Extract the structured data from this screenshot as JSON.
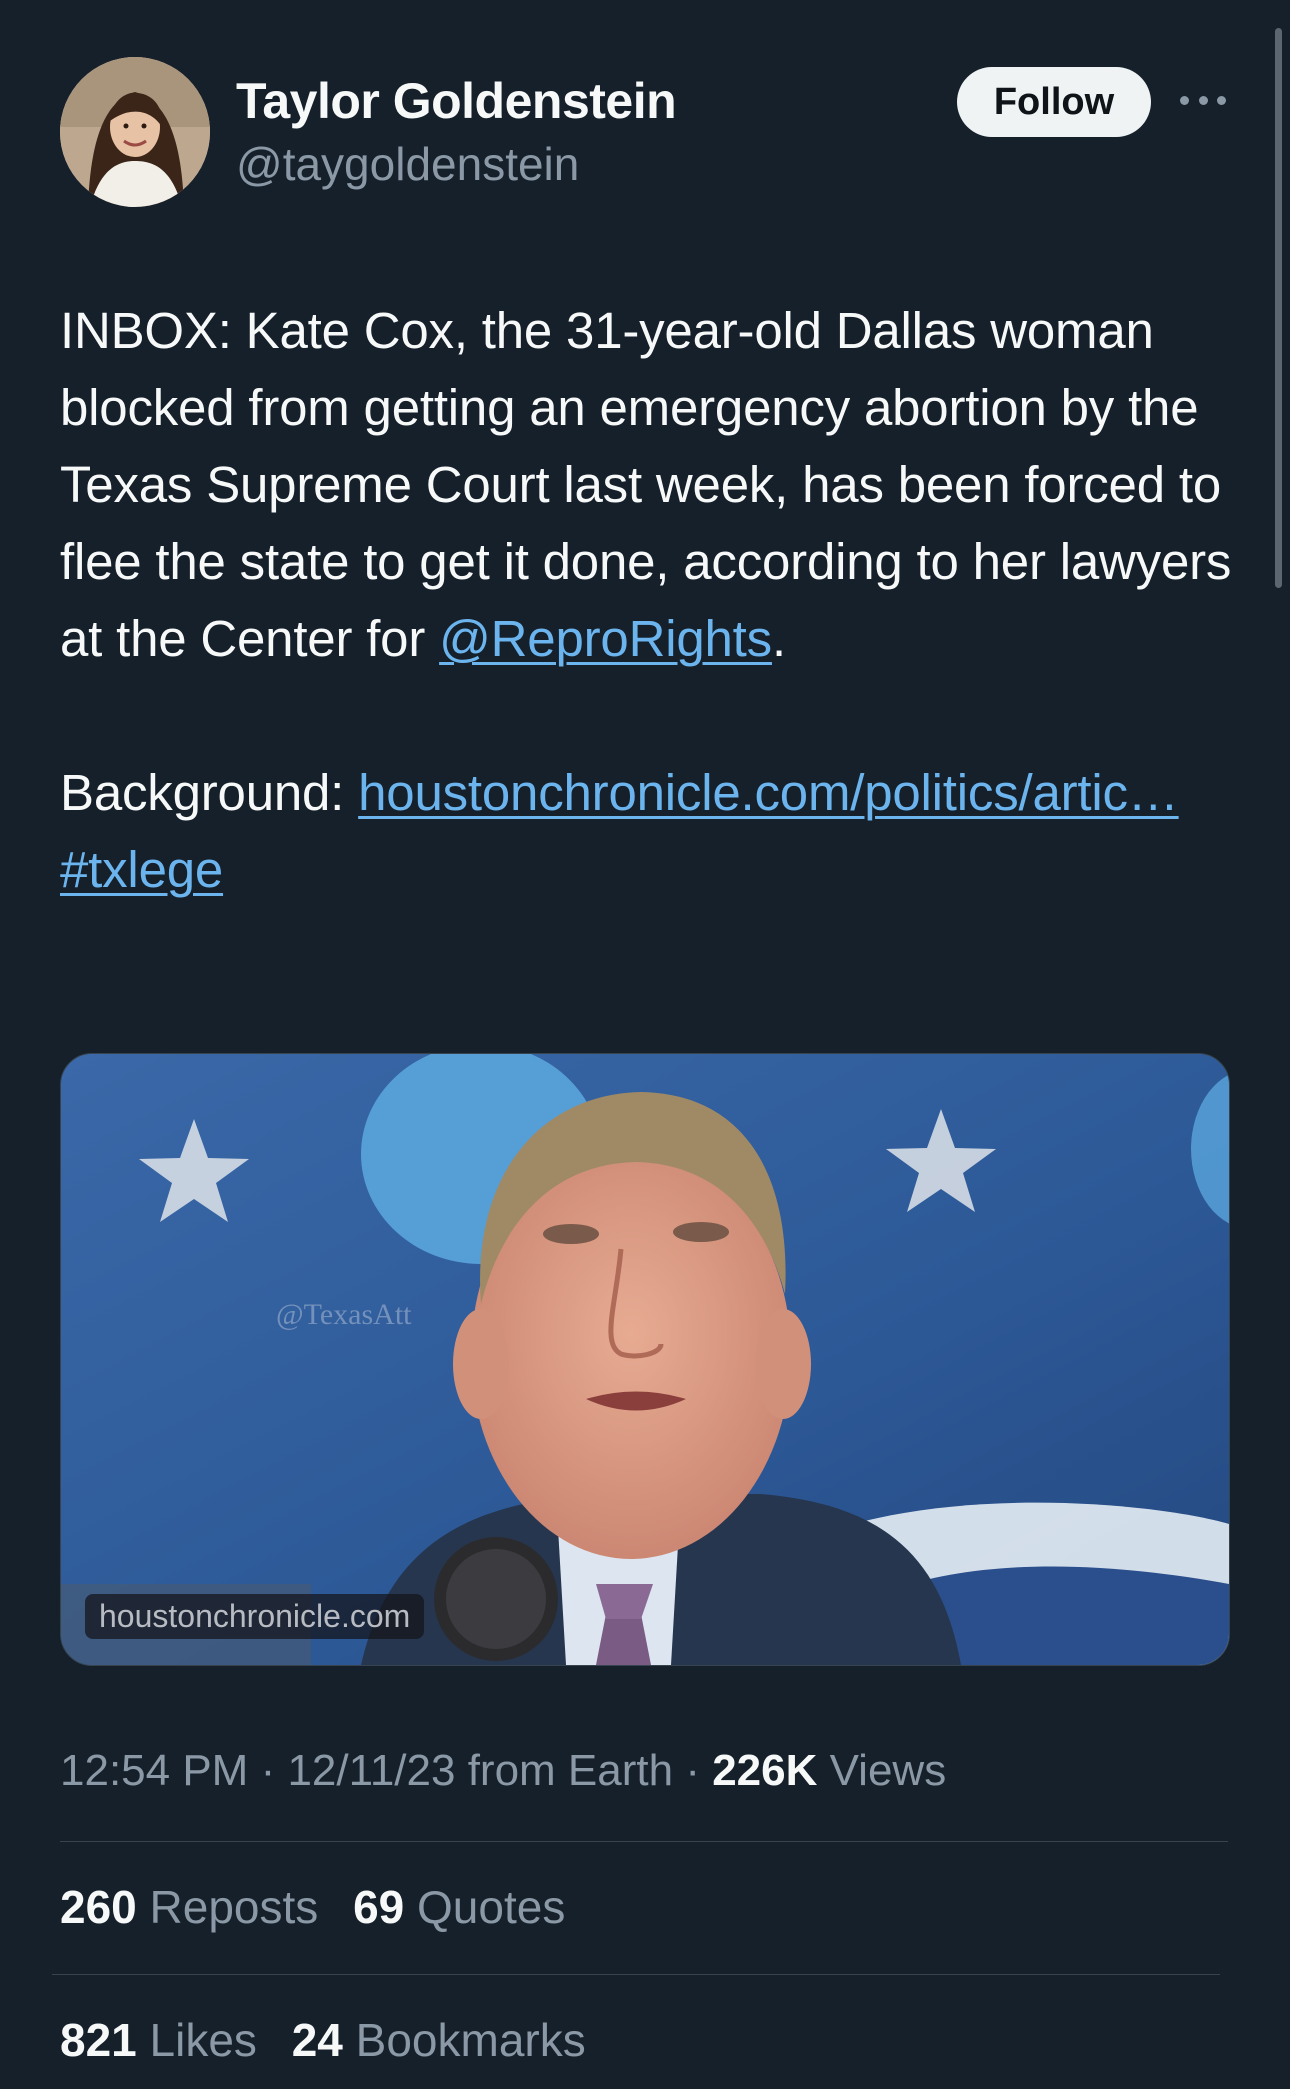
{
  "author": {
    "display_name": "Taylor Goldenstein",
    "handle": "@taygoldenstein",
    "follow_label": "Follow"
  },
  "tweet": {
    "text_part1": "INBOX: Kate Cox, the 31-year-old Dallas woman blocked from getting an emergency abortion by the Texas Supreme Court last week, has been forced to flee the state to get it done, according to her lawyers at the Center for ",
    "mention": "@ReproRights",
    "text_part1_end": ".",
    "background_label": "Background: ",
    "link_text": "houstonchronicle.com/politics/artic…",
    "hashtag": "#txlege"
  },
  "media": {
    "caption": "houstonchronicle.com"
  },
  "meta": {
    "time": "12:54 PM",
    "separator1": " · ",
    "date": "12/11/23",
    "source": " from Earth",
    "separator2": " · ",
    "views_count": "226K",
    "views_label": " Views"
  },
  "stats": {
    "reposts_count": "260",
    "reposts_label": "Reposts",
    "quotes_count": "69",
    "quotes_label": "Quotes",
    "likes_count": "821",
    "likes_label": "Likes",
    "bookmarks_count": "24",
    "bookmarks_label": "Bookmarks"
  },
  "colors": {
    "background": "#15202b",
    "link": "#6cb4ee",
    "secondary_text": "#8b98a5",
    "primary_text": "#f7f9f9"
  },
  "icons": [
    "more-horizontal-icon"
  ]
}
